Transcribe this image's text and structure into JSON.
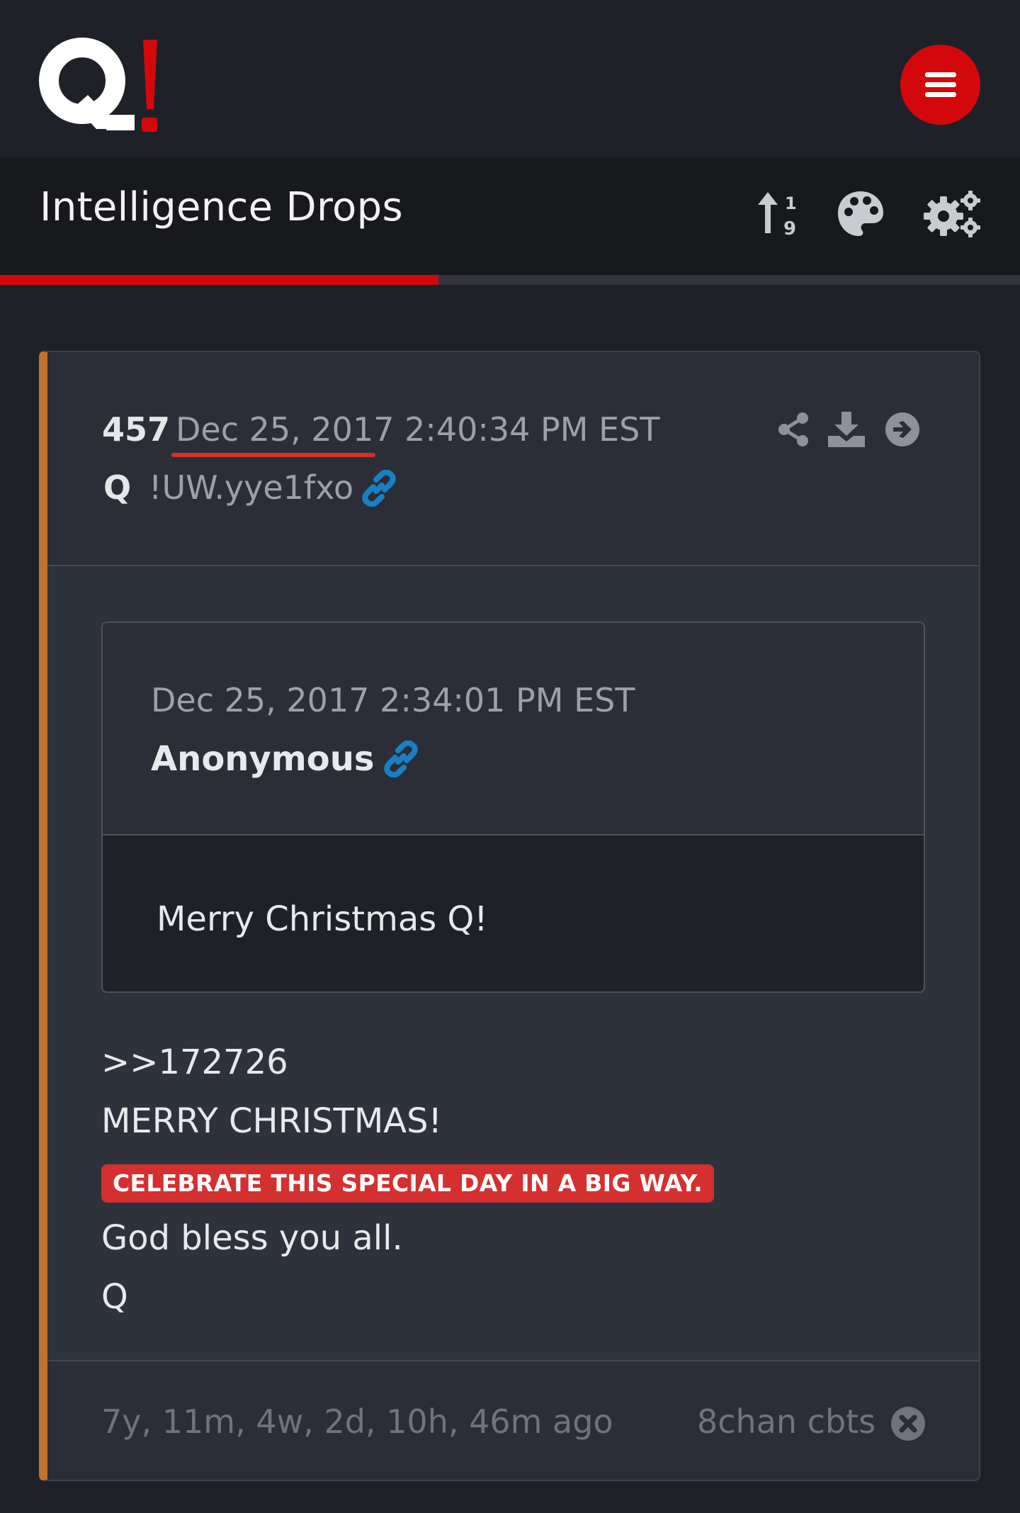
{
  "header": {
    "logo_text": "Q!",
    "menu_icon": "hamburger-icon"
  },
  "titlebar": {
    "title": "Intelligence Drops",
    "tools": [
      {
        "icon": "sort-numeric-icon"
      },
      {
        "icon": "palette-icon"
      },
      {
        "icon": "gears-icon"
      }
    ]
  },
  "progress": {
    "fraction": 0.43
  },
  "drop": {
    "number": "457",
    "date": "Dec 25, 2017 2:40:34 PM EST",
    "author": "Q",
    "tripcode": "!UW.yye1fxo",
    "actions": [
      "share-icon",
      "download-icon",
      "arrow-right-icon"
    ],
    "quote": {
      "date": "Dec 25, 2017 2:34:01 PM EST",
      "author": "Anonymous",
      "text": "Merry Christmas Q!"
    },
    "lines": [
      ">>172726",
      "MERRY CHRISTMAS!"
    ],
    "highlight": "CELEBRATE THIS SPECIAL DAY IN A BIG WAY.",
    "lines_after": [
      "God bless you all.",
      "Q"
    ],
    "footer": {
      "ago": "7y, 11m, 4w, 2d, 10h, 46m ago",
      "source": "8chan cbts"
    }
  },
  "colors": {
    "accent_red": "#d3080b",
    "card_border_left": "#c0712c",
    "link_blue": "#1a7fc4",
    "highlight_bg": "#d3302f"
  }
}
